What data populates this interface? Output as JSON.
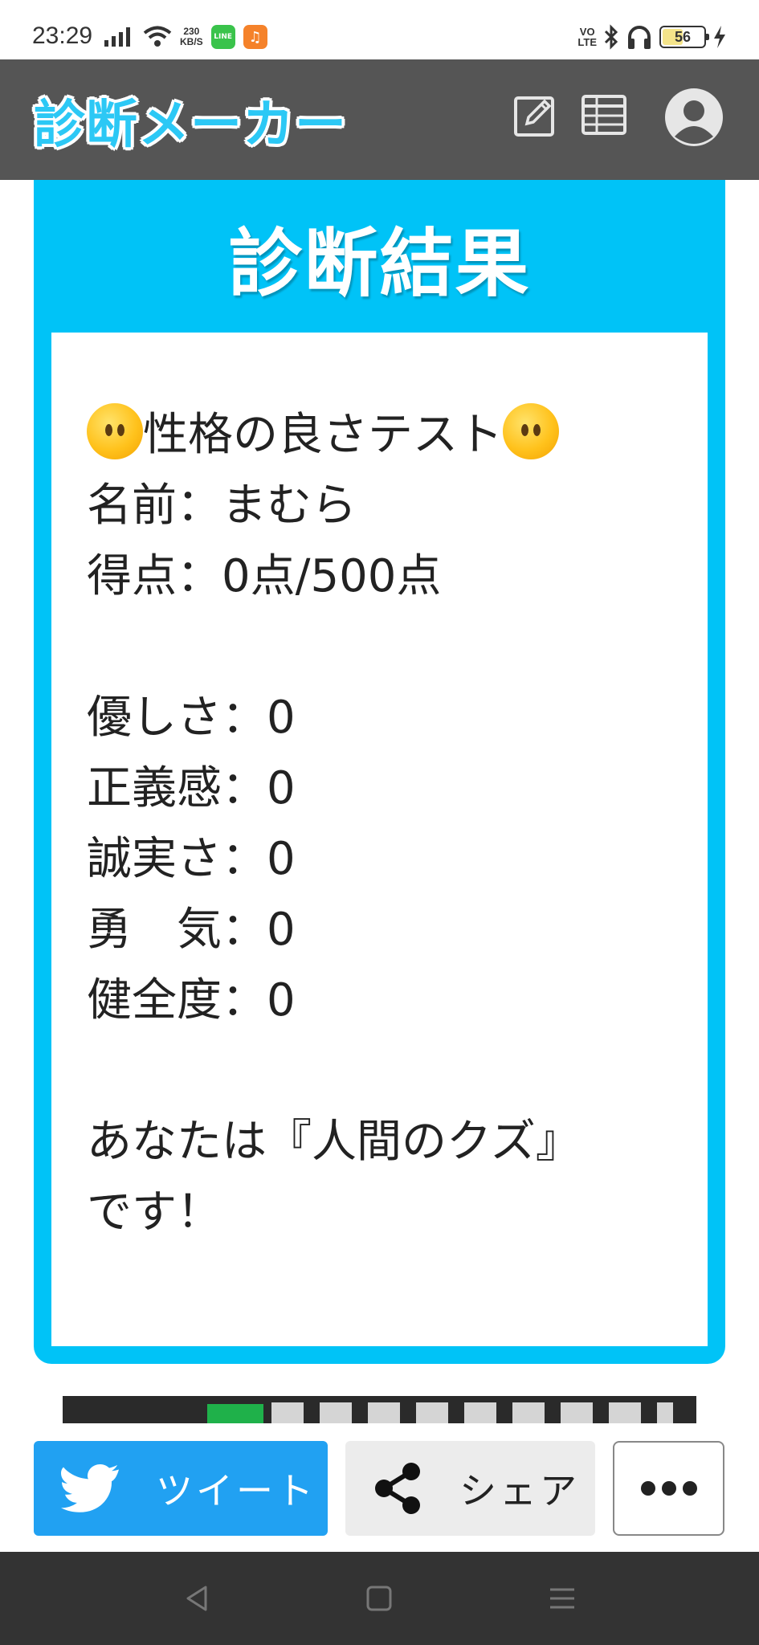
{
  "status_bar": {
    "time": "23:29",
    "net_speed_value": "230",
    "net_speed_unit": "KB/S",
    "app_icons": [
      "line-app-icon",
      "music-app-icon"
    ],
    "volte_top": "VO",
    "volte_bottom": "LTE",
    "battery_level": "56",
    "icons": [
      "signal-icon",
      "wifi-icon",
      "bluetooth-icon",
      "headphones-icon",
      "battery-icon",
      "charging-icon"
    ]
  },
  "header": {
    "logo_text": "診断メーカー",
    "icons": [
      "edit-icon",
      "table-icon",
      "user-avatar-icon"
    ],
    "colors": {
      "background": "#555555",
      "logo": "#2cc8f5"
    }
  },
  "result_card": {
    "title": "診断結果",
    "accent_color": "#00c3f7",
    "lines": [
      {
        "text": "性格の良さテスト",
        "emoji": "expressionless-face"
      },
      {
        "text": "名前：まむら"
      },
      {
        "text": "得点：0点/500点"
      },
      {
        "text": ""
      },
      {
        "text": "優しさ：0"
      },
      {
        "text": "正義感：0"
      },
      {
        "text": "誠実さ：0"
      },
      {
        "text": "勇　気：0"
      },
      {
        "text": "健全度：0"
      },
      {
        "text": ""
      },
      {
        "text": "あなたは『人間のクズ』"
      },
      {
        "text": "です！"
      }
    ]
  },
  "share_bar": {
    "tweet_label": "ツイート",
    "share_label": "シェア",
    "more_icon": "more-dots-icon",
    "colors": {
      "tweet": "#21a1f2",
      "share": "#ececec"
    }
  },
  "nav_bar": {
    "icons": [
      "back-icon",
      "home-icon",
      "menu-icon"
    ]
  }
}
